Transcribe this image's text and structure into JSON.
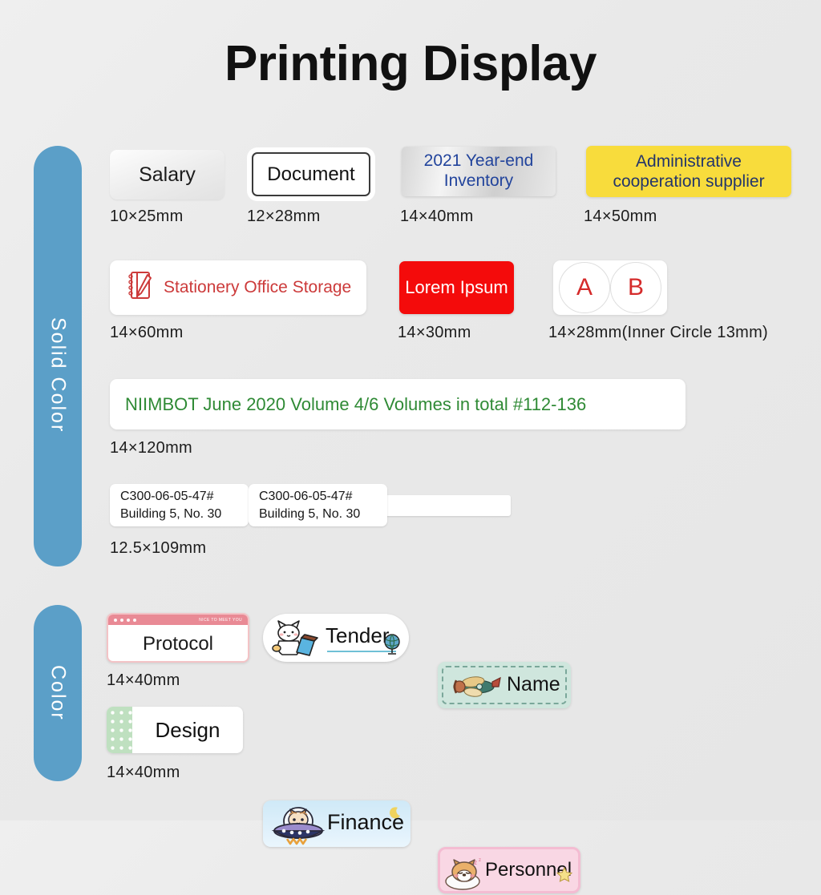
{
  "page": {
    "title": "Printing Display",
    "background_color": "#ebebeb"
  },
  "sidebar": {
    "accent_color": "#5b9fc8",
    "tabs": [
      {
        "id": "solid-color",
        "label": "Solid Color"
      },
      {
        "id": "color",
        "label": "Color"
      }
    ]
  },
  "solid_color_section": {
    "rows": [
      {
        "labels": [
          {
            "text": "Salary",
            "size": "10×25mm",
            "style": "silver-gradient",
            "text_color": "#1c1c1c"
          },
          {
            "text": "Document",
            "size": "12×28mm",
            "style": "white-outlined",
            "text_color": "#111111"
          },
          {
            "line1": "2021 Year-end",
            "line2": "Inventory",
            "size": "14×40mm",
            "style": "silver-foil",
            "text_color": "#22449c"
          },
          {
            "line1": "Administrative",
            "line2": "cooperation supplier",
            "size": "14×50mm",
            "style": "yellow",
            "background": "#f8dc3c",
            "text_color": "#23356b"
          }
        ]
      },
      {
        "labels": [
          {
            "text": "Stationery Office Storage",
            "size": "14×60mm",
            "style": "white-with-icon",
            "icon": "notebook-pencil-icon",
            "text_color": "#cc3a3a"
          },
          {
            "text": "Lorem Ipsum",
            "size": "14×30mm",
            "style": "red",
            "background": "#f40b0b",
            "text_color": "#ffffff"
          },
          {
            "circle_a": "A",
            "circle_b": "B",
            "size": "14×28mm(Inner Circle  13mm)",
            "style": "two-circles",
            "text_color": "#d52b2b"
          }
        ]
      },
      {
        "labels": [
          {
            "text": "NIIMBOT June 2020 Volume 4/6 Volumes in total #112-136",
            "size": "14×120mm",
            "style": "white-wide",
            "text_color": "#2f8a35"
          }
        ]
      },
      {
        "labels": [
          {
            "box1_line1": "C300-06-05-47#",
            "box1_line2": "Building 5, No. 30",
            "box2_line1": "C300-06-05-47#",
            "box2_line2": "Building 5, No. 30",
            "size": "12.5×109mm",
            "style": "cable-flag",
            "text_color": "#161616"
          }
        ]
      }
    ]
  },
  "color_section": {
    "rows": [
      {
        "size": "14×40mm",
        "labels": [
          {
            "text": "Protocol",
            "style": "pink-window",
            "header_tag": "NICE TO MEET YOU",
            "accent": "#e98a95"
          },
          {
            "text": "Tender",
            "style": "cat-sticker",
            "icon": "white-cat-icon",
            "secondary_icon": "globe-icon"
          },
          {
            "text": "Name",
            "style": "mint-dashed",
            "background": "#cfe6dd",
            "icon": "airplane-icon"
          }
        ]
      },
      {
        "size": "14×40mm",
        "labels": [
          {
            "text": "Design",
            "style": "green-dot-strip",
            "accent": "#bfe0c0"
          },
          {
            "text": "Finance",
            "style": "blue-sky-ufo",
            "icon": "cat-ufo-icon",
            "secondary_icon": "moon-icon"
          },
          {
            "text": "Personnel",
            "style": "pink-shiba",
            "background": "#f9d7e4",
            "icon": "shiba-dog-icon",
            "secondary_icon": "star-icon"
          }
        ]
      }
    ]
  }
}
